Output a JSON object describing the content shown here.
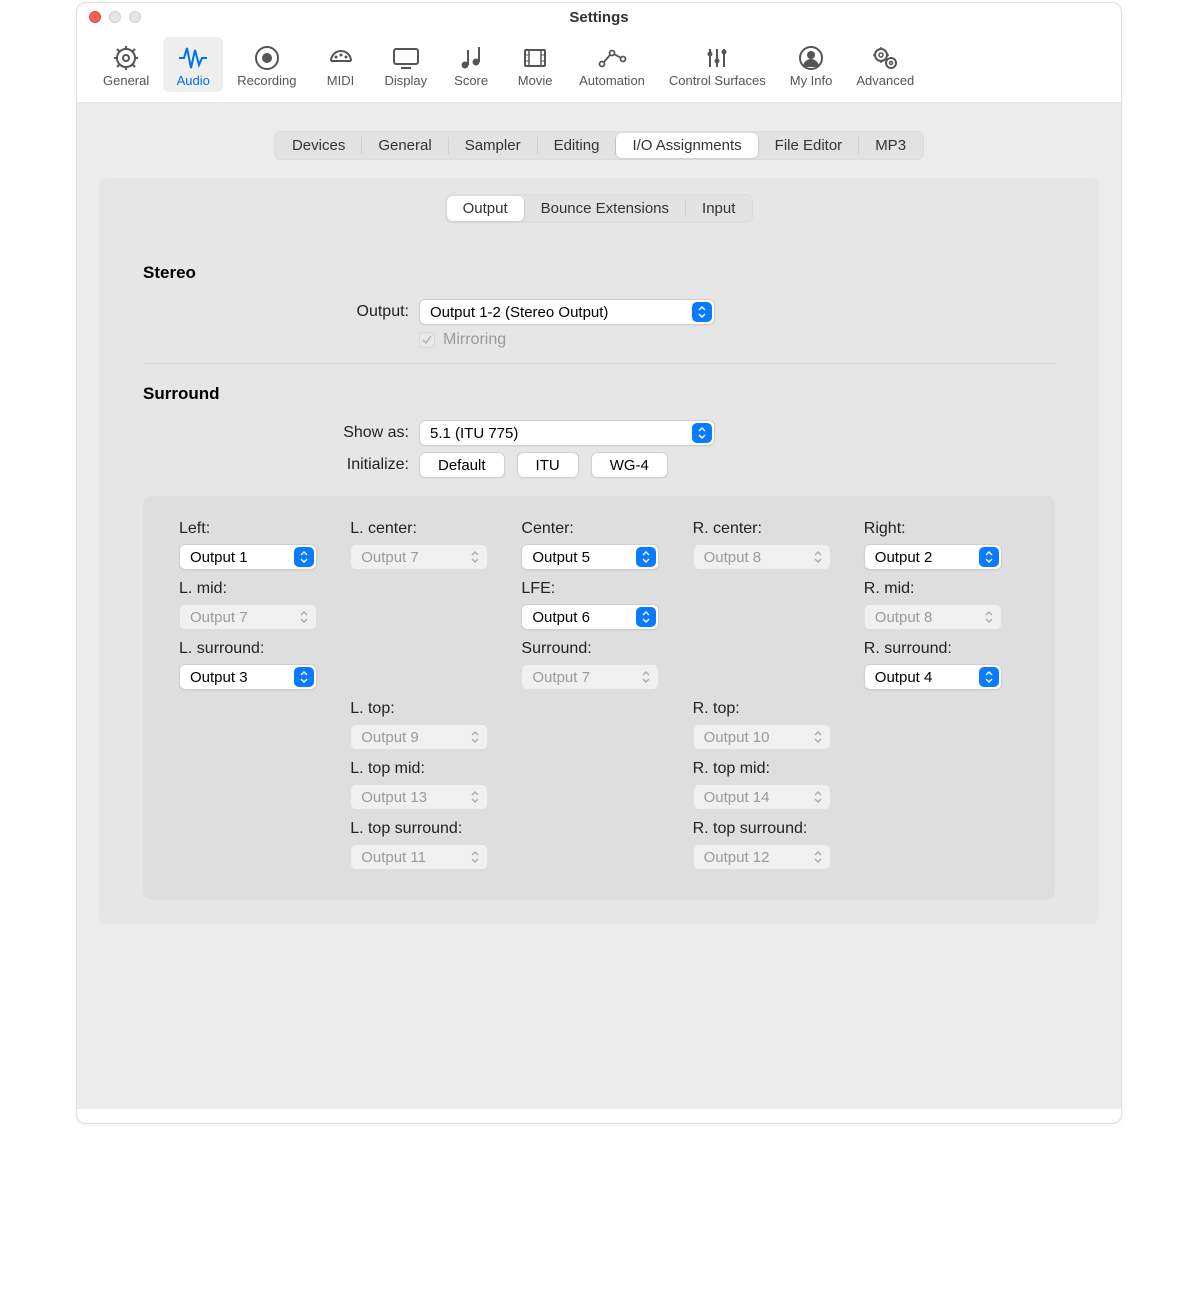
{
  "window": {
    "title": "Settings"
  },
  "toolbar": [
    {
      "id": "general",
      "label": "General"
    },
    {
      "id": "audio",
      "label": "Audio",
      "active": true
    },
    {
      "id": "recording",
      "label": "Recording"
    },
    {
      "id": "midi",
      "label": "MIDI"
    },
    {
      "id": "display",
      "label": "Display"
    },
    {
      "id": "score",
      "label": "Score"
    },
    {
      "id": "movie",
      "label": "Movie"
    },
    {
      "id": "automation",
      "label": "Automation"
    },
    {
      "id": "control-surfaces",
      "label": "Control Surfaces"
    },
    {
      "id": "my-info",
      "label": "My Info"
    },
    {
      "id": "advanced",
      "label": "Advanced"
    }
  ],
  "tabs1": [
    "Devices",
    "General",
    "Sampler",
    "Editing",
    "I/O Assignments",
    "File Editor",
    "MP3"
  ],
  "tabs1_active": 4,
  "tabs2": [
    "Output",
    "Bounce Extensions",
    "Input"
  ],
  "tabs2_active": 0,
  "stereo": {
    "title": "Stereo",
    "output_label": "Output:",
    "output_value": "Output 1-2 (Stereo Output)",
    "mirroring_label": "Mirroring",
    "mirroring_checked": true
  },
  "surround": {
    "title": "Surround",
    "show_as_label": "Show as:",
    "show_as_value": "5.1 (ITU 775)",
    "init_label": "Initialize:",
    "init_buttons": [
      "Default",
      "ITU",
      "WG-4"
    ]
  },
  "channels": {
    "r0": [
      {
        "label": "Left:",
        "value": "Output 1",
        "enabled": true
      },
      {
        "label": "L. center:",
        "value": "Output 7",
        "enabled": false
      },
      {
        "label": "Center:",
        "value": "Output 5",
        "enabled": true
      },
      {
        "label": "R. center:",
        "value": "Output 8",
        "enabled": false
      },
      {
        "label": "Right:",
        "value": "Output 2",
        "enabled": true
      }
    ],
    "r1": [
      {
        "label": "L. mid:",
        "value": "Output 7",
        "enabled": false
      },
      null,
      {
        "label": "LFE:",
        "value": "Output 6",
        "enabled": true
      },
      null,
      {
        "label": "R. mid:",
        "value": "Output 8",
        "enabled": false
      }
    ],
    "r2": [
      {
        "label": "L. surround:",
        "value": "Output 3",
        "enabled": true
      },
      null,
      {
        "label": "Surround:",
        "value": "Output 7",
        "enabled": false
      },
      null,
      {
        "label": "R. surround:",
        "value": "Output 4",
        "enabled": true
      }
    ],
    "r3": [
      null,
      {
        "label": "L. top:",
        "value": "Output 9",
        "enabled": false
      },
      null,
      {
        "label": "R. top:",
        "value": "Output 10",
        "enabled": false
      },
      null
    ],
    "r4": [
      null,
      {
        "label": "L. top mid:",
        "value": "Output 13",
        "enabled": false
      },
      null,
      {
        "label": "R. top mid:",
        "value": "Output 14",
        "enabled": false
      },
      null
    ],
    "r5": [
      null,
      {
        "label": "L. top surround:",
        "value": "Output 11",
        "enabled": false
      },
      null,
      {
        "label": "R. top surround:",
        "value": "Output 12",
        "enabled": false
      },
      null
    ]
  }
}
